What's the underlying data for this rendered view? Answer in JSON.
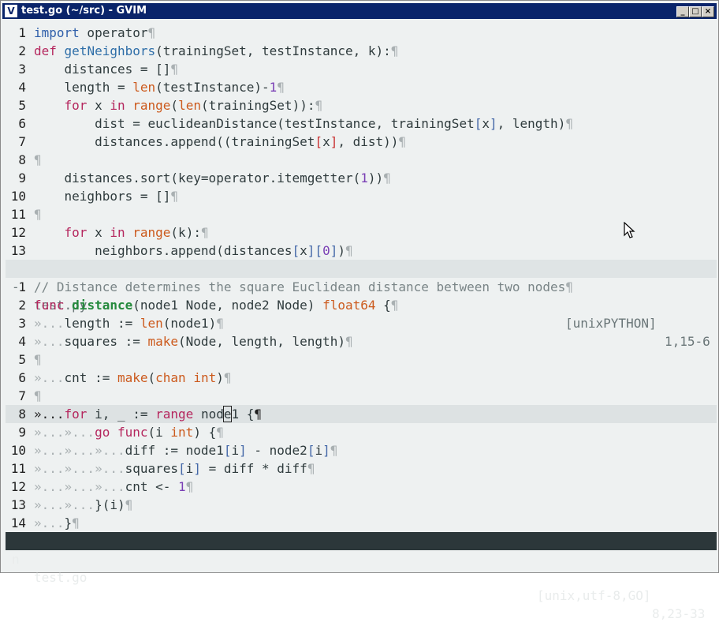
{
  "window": {
    "title": "test.go (~/src) - GVIM",
    "app_icon_glyph": "V",
    "minimize_glyph": "_",
    "maximize_glyph": "□",
    "close_glyph": "×"
  },
  "top_pane": {
    "lines": [
      {
        "n": "1"
      },
      {
        "n": "2"
      },
      {
        "n": "3"
      },
      {
        "n": "4"
      },
      {
        "n": "5"
      },
      {
        "n": "6"
      },
      {
        "n": "7"
      },
      {
        "n": "8"
      },
      {
        "n": "9"
      },
      {
        "n": "10"
      },
      {
        "n": "11"
      },
      {
        "n": "12"
      },
      {
        "n": "13"
      }
    ],
    "status": {
      "mode": "-",
      "file": "test.py",
      "format": "[unixPYTHON]",
      "position": "1,15-6"
    }
  },
  "bottom_pane": {
    "lines": [
      {
        "n": "1"
      },
      {
        "n": "2"
      },
      {
        "n": "3"
      },
      {
        "n": "4"
      },
      {
        "n": "5"
      },
      {
        "n": "6"
      },
      {
        "n": "7"
      },
      {
        "n": "8"
      },
      {
        "n": "9"
      },
      {
        "n": "10"
      },
      {
        "n": "11"
      },
      {
        "n": "12"
      },
      {
        "n": "13"
      },
      {
        "n": "14"
      }
    ],
    "status": {
      "mode": "n",
      "file": "test.go",
      "format": "[unix,utf-8,GO]",
      "position": "8,23-33"
    }
  },
  "colors": {
    "background": "#eef1f1",
    "keyword": "#b5275e",
    "function": "#2e6ea8",
    "builtin": "#cc5a1d",
    "number": "#7a3fb5",
    "comment": "#7a8587",
    "active_status": "#2c373a"
  }
}
